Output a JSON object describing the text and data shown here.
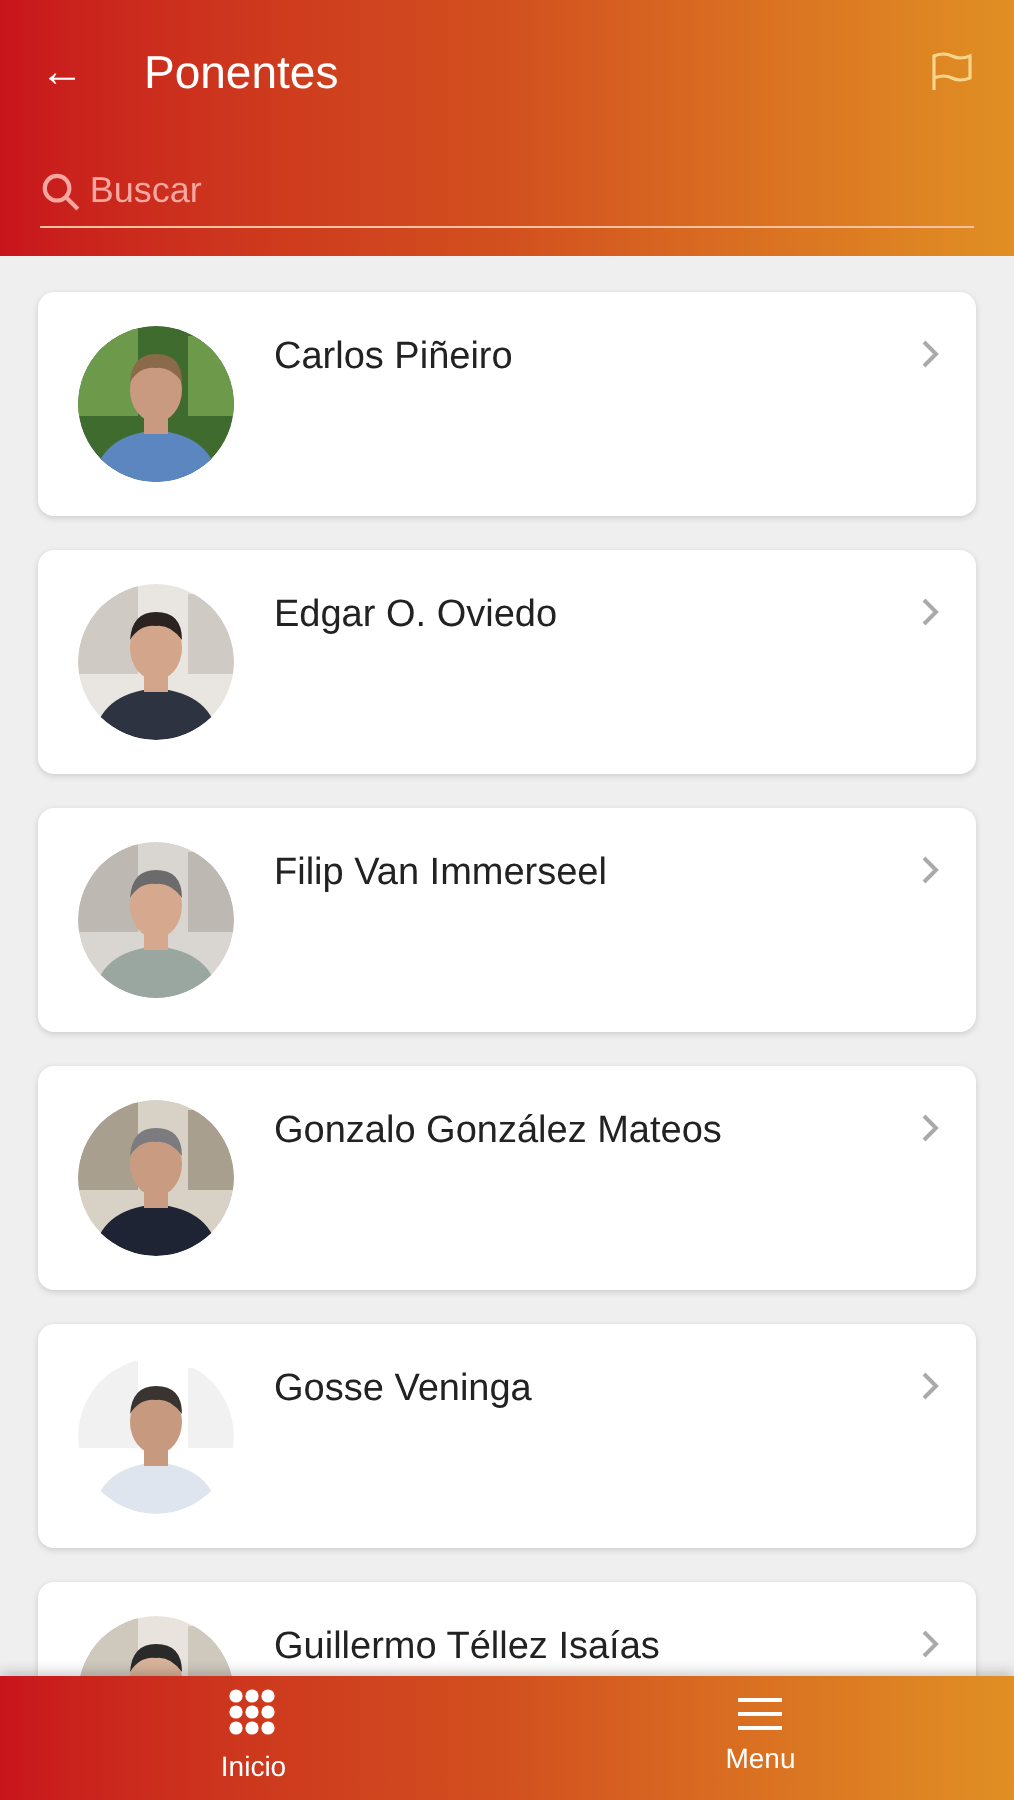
{
  "header": {
    "back": "←",
    "title": "Ponentes"
  },
  "search": {
    "placeholder": "Buscar"
  },
  "speakers": [
    {
      "name": "Carlos Piñeiro"
    },
    {
      "name": "Edgar O. Oviedo"
    },
    {
      "name": "Filip Van Immerseel"
    },
    {
      "name": "Gonzalo González Mateos"
    },
    {
      "name": "Gosse Veninga"
    },
    {
      "name": "Guillermo Téllez Isaías"
    }
  ],
  "bottom_nav": [
    {
      "label": "Inicio",
      "kind": "grid"
    },
    {
      "label": "Menu",
      "kind": "menu"
    }
  ]
}
